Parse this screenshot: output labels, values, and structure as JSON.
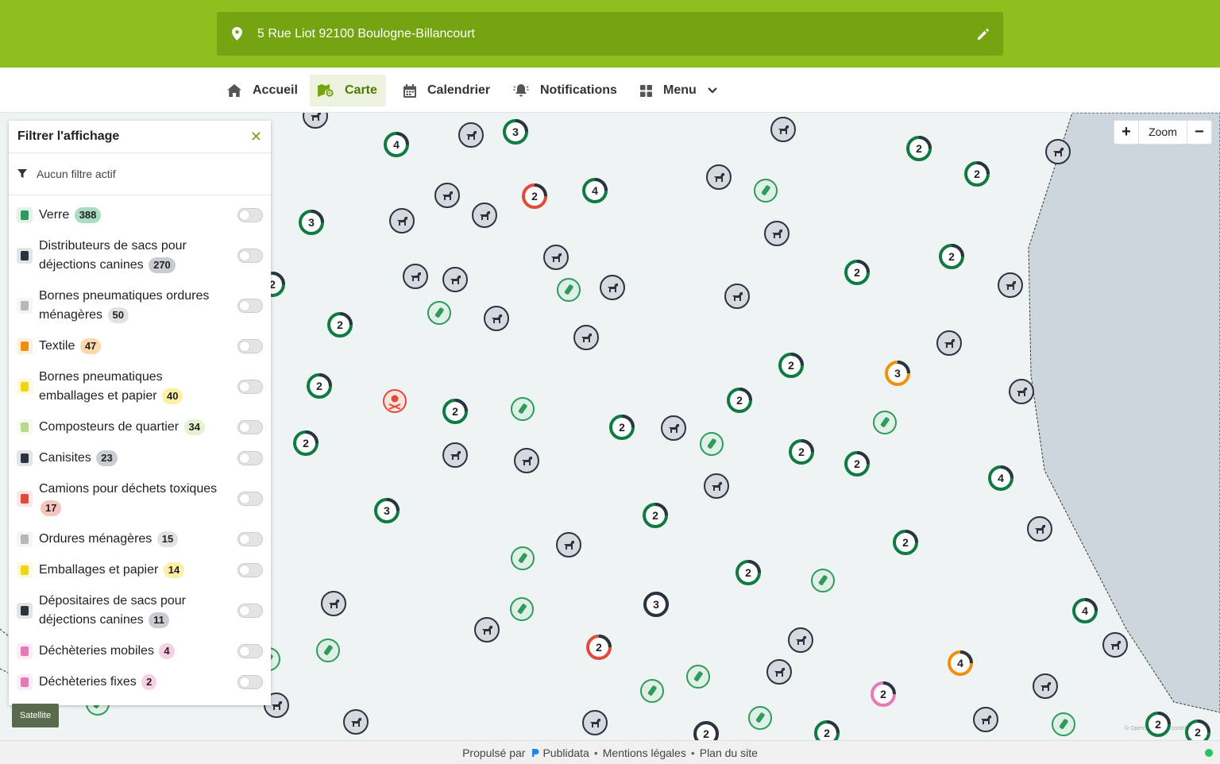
{
  "header": {
    "address": "5 Rue Liot 92100 Boulogne-Billancourt"
  },
  "nav": [
    {
      "label": "Accueil",
      "icon": "home-icon"
    },
    {
      "label": "Carte",
      "icon": "map-icon",
      "active": true
    },
    {
      "label": "Calendrier",
      "icon": "calendar-icon"
    },
    {
      "label": "Notifications",
      "icon": "bell-icon"
    },
    {
      "label": "Menu",
      "icon": "grid-icon"
    }
  ],
  "filter": {
    "title": "Filtrer l'affichage",
    "status": "Aucun filtre actif",
    "items": [
      {
        "label": "Verre",
        "count": "388",
        "color": "#2f9a5b",
        "badge_bg": "#a9dcc0"
      },
      {
        "label": "Distributeurs de sacs pour déjections canines",
        "count": "270",
        "color": "#2b3340",
        "badge_bg": "#c9ccd1"
      },
      {
        "label": "Bornes pneumatiques ordures ménagères",
        "count": "50",
        "color": "#b7b7b7",
        "badge_bg": "#e2e2e2"
      },
      {
        "label": "Textile",
        "count": "47",
        "color": "#f0900f",
        "badge_bg": "#fbd9a8"
      },
      {
        "label": "Bornes pneumatiques emballages et papier",
        "count": "40",
        "color": "#f2d512",
        "badge_bg": "#fbf0a3"
      },
      {
        "label": "Composteurs de quartier",
        "count": "34",
        "color": "#b8d98a",
        "badge_bg": "#e6f1cf"
      },
      {
        "label": "Canisites",
        "count": "23",
        "color": "#2b3340",
        "badge_bg": "#c9ccd1"
      },
      {
        "label": "Camions pour déchets toxiques",
        "count": "17",
        "color": "#e04a3a",
        "badge_bg": "#f6c4bd"
      },
      {
        "label": "Ordures ménagères",
        "count": "15",
        "color": "#b7b7b7",
        "badge_bg": "#e2e2e2"
      },
      {
        "label": "Emballages et papier",
        "count": "14",
        "color": "#f2d512",
        "badge_bg": "#fbf0a3"
      },
      {
        "label": "Dépositaires de sacs pour déjections canines",
        "count": "11",
        "color": "#2b3340",
        "badge_bg": "#c9ccd1"
      },
      {
        "label": "Déchèteries mobiles",
        "count": "4",
        "color": "#e879b7",
        "badge_bg": "#f8d0e5"
      },
      {
        "label": "Déchèteries fixes",
        "count": "2",
        "color": "#e879b7",
        "badge_bg": "#f8d0e5"
      }
    ]
  },
  "map": {
    "zoom_label": "Zoom",
    "zoom_in": "+",
    "zoom_out": "−",
    "satellite_label": "Satellite",
    "attribution": "© OpenStreetMap contributors",
    "clusters": [
      {
        "n": "4",
        "c": "#0f7a42"
      },
      {
        "n": "3",
        "c": "#0f7a42"
      },
      {
        "n": "2",
        "c": "#e04a3a"
      },
      {
        "n": "4",
        "c": "#0f7a42"
      },
      {
        "n": "3",
        "c": "#0f7a42"
      },
      {
        "n": "2",
        "c": "#0f7a42"
      },
      {
        "n": "2",
        "c": "#0f7a42"
      },
      {
        "n": "2",
        "c": "#0f7a42"
      },
      {
        "n": "2",
        "c": "#0f7a42"
      },
      {
        "n": "2",
        "c": "#0f7a42"
      },
      {
        "n": "2",
        "c": "#0f7a42"
      },
      {
        "n": "2",
        "c": "#0f7a42"
      },
      {
        "n": "2",
        "c": "#0f7a42"
      },
      {
        "n": "2",
        "c": "#0f7a42"
      },
      {
        "n": "3",
        "c": "#f0900f"
      },
      {
        "n": "2",
        "c": "#0f7a42"
      },
      {
        "n": "2",
        "c": "#0f7a42"
      },
      {
        "n": "2",
        "c": "#0f7a42"
      },
      {
        "n": "4",
        "c": "#0f7a42"
      },
      {
        "n": "3",
        "c": "#0f7a42"
      },
      {
        "n": "2",
        "c": "#0f7a42"
      },
      {
        "n": "2",
        "c": "#0f7a42"
      },
      {
        "n": "2",
        "c": "#0f7a42"
      },
      {
        "n": "3",
        "c": "#2b3340"
      },
      {
        "n": "2",
        "c": "#e04a3a"
      },
      {
        "n": "4",
        "c": "#f0900f"
      },
      {
        "n": "2",
        "c": "#e879b7"
      },
      {
        "n": "4",
        "c": "#0f7a42"
      },
      {
        "n": "2",
        "c": "#0f7a42"
      },
      {
        "n": "2",
        "c": "#2b3340"
      },
      {
        "n": "2",
        "c": "#0f7a42"
      },
      {
        "n": "2",
        "c": "#0f7a42"
      },
      {
        "n": "2",
        "c": "#0f7a42"
      },
      {
        "n": "2",
        "c": "#0f7a42"
      }
    ]
  },
  "footer": {
    "powered_by": "Propulsé par",
    "brand": "Publidata",
    "legal": "Mentions légales",
    "sitemap": "Plan du site"
  }
}
